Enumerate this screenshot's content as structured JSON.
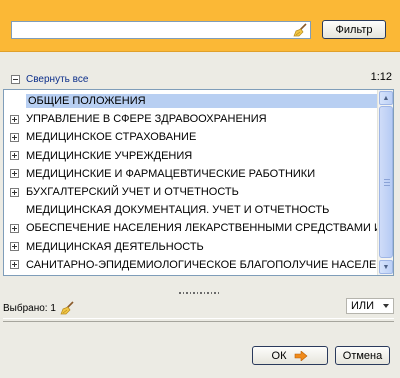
{
  "filter": {
    "value": "",
    "placeholder": "",
    "clear_icon": "broom-icon",
    "button_label": "Фильтр"
  },
  "toolbar": {
    "collapse_label": "Свернуть все",
    "counter": "1:12"
  },
  "tree": {
    "items": [
      {
        "label": "ОБЩИЕ ПОЛОЖЕНИЯ",
        "expandable": false,
        "selected": true
      },
      {
        "label": "УПРАВЛЕНИЕ В СФЕРЕ ЗДРАВООХРАНЕНИЯ",
        "expandable": true,
        "selected": false
      },
      {
        "label": "МЕДИЦИНСКОЕ СТРАХОВАНИЕ",
        "expandable": true,
        "selected": false
      },
      {
        "label": "МЕДИЦИНСКИЕ УЧРЕЖДЕНИЯ",
        "expandable": true,
        "selected": false
      },
      {
        "label": "МЕДИЦИНСКИЕ И ФАРМАЦЕВТИЧЕСКИЕ РАБОТНИКИ",
        "expandable": true,
        "selected": false
      },
      {
        "label": "БУХГАЛТЕРСКИЙ УЧЕТ И ОТЧЕТНОСТЬ",
        "expandable": true,
        "selected": false
      },
      {
        "label": "МЕДИЦИНСКАЯ ДОКУМЕНТАЦИЯ. УЧЕТ И ОТЧЕТНОСТЬ",
        "expandable": false,
        "selected": false
      },
      {
        "label": "ОБЕСПЕЧЕНИЕ НАСЕЛЕНИЯ ЛЕКАРСТВЕННЫМИ СРЕДСТВАМИ И ИЗДЕЛИЯМИ",
        "expandable": true,
        "selected": false
      },
      {
        "label": "МЕДИЦИНСКАЯ ДЕЯТЕЛЬНОСТЬ",
        "expandable": true,
        "selected": false
      },
      {
        "label": "САНИТАРНО-ЭПИДЕМИОЛОГИЧЕСКОЕ БЛАГОПОЛУЧИЕ НАСЕЛЕНИЯ",
        "expandable": true,
        "selected": false
      }
    ]
  },
  "footer": {
    "selected_label": "Выбрано: 1",
    "logic_select": "ИЛИ",
    "ok_label": "ОК",
    "cancel_label": "Отмена"
  },
  "colors": {
    "top_bar": "#fbb836",
    "selection": "#b8cff2",
    "link": "#0b2e8a",
    "ok_arrow": "#f08a1a"
  }
}
